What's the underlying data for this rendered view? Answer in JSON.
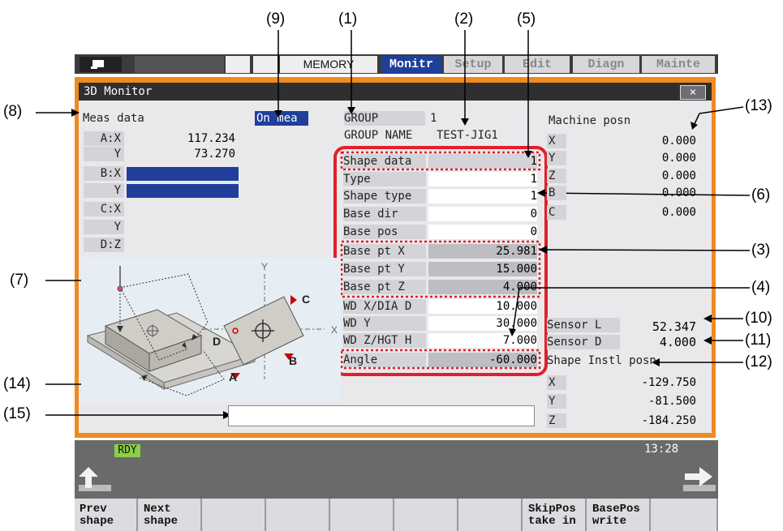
{
  "callouts": [
    "(1)",
    "(2)",
    "(3)",
    "(4)",
    "(5)",
    "(6)",
    "(7)",
    "(8)",
    "(9)",
    "(10)",
    "(11)",
    "(12)",
    "(13)",
    "(14)",
    "(15)"
  ],
  "topbar": {
    "mode": "MEMORY",
    "tabs": [
      "Monitr",
      "Setup",
      "Edit",
      "Diagn",
      "Mainte"
    ]
  },
  "window": {
    "title": "3D Monitor",
    "close": "×"
  },
  "meas": {
    "label": "Meas data",
    "status": "On mea",
    "rows": [
      {
        "label": "A:X",
        "value": "117.234"
      },
      {
        "label": "Y",
        "value": "73.270"
      },
      {
        "label": "B:X",
        "value": ""
      },
      {
        "label": "Y",
        "value": ""
      },
      {
        "label": "C:X",
        "value": ""
      },
      {
        "label": "Y",
        "value": ""
      },
      {
        "label": "D:Z",
        "value": ""
      }
    ]
  },
  "group": {
    "label": "GROUP",
    "value": "1",
    "name_label": "GROUP NAME",
    "name_value": "TEST-JIG1"
  },
  "shape": {
    "rows": [
      {
        "label": "Shape data",
        "value": "1"
      },
      {
        "label": "Type",
        "value": "1"
      },
      {
        "label": "Shape type",
        "value": "1"
      },
      {
        "label": "Base dir",
        "value": "0"
      },
      {
        "label": "Base pos",
        "value": "0"
      },
      {
        "label": "Base pt X",
        "value": "25.981"
      },
      {
        "label": "Base pt Y",
        "value": "15.000"
      },
      {
        "label": "Base pt Z",
        "value": "4.000"
      },
      {
        "label": "WD X/DIA D",
        "value": "10.000"
      },
      {
        "label": "WD Y",
        "value": "30.000"
      },
      {
        "label": "WD Z/HGT H",
        "value": "7.000"
      },
      {
        "label": "Angle",
        "value": "-60.000"
      }
    ]
  },
  "machine": {
    "label": "Machine posn",
    "rows": [
      {
        "label": "X",
        "value": "0.000"
      },
      {
        "label": "Y",
        "value": "0.000"
      },
      {
        "label": "Z",
        "value": "0.000"
      },
      {
        "label": "B",
        "value": "0.000"
      },
      {
        "label": "C",
        "value": "0.000"
      }
    ]
  },
  "sensor": {
    "l_label": "Sensor L",
    "l_value": "52.347",
    "d_label": "Sensor D",
    "d_value": "4.000"
  },
  "instl": {
    "label": "Shape Instl posn",
    "rows": [
      {
        "label": "X",
        "value": "-129.750"
      },
      {
        "label": "Y",
        "value": "-81.500"
      },
      {
        "label": "Z",
        "value": "-184.250"
      }
    ]
  },
  "diagram": {
    "axis_y": "Y",
    "axis_x": "X",
    "pt_a": "A",
    "pt_b": "B",
    "pt_c": "C",
    "pt_d": "D"
  },
  "status": {
    "rdy": "RDY",
    "time": "13:28"
  },
  "fkeys": [
    {
      "l1": "Prev",
      "l2": "shape"
    },
    {
      "l1": "Next",
      "l2": "shape"
    },
    {
      "l1": "",
      "l2": ""
    },
    {
      "l1": "",
      "l2": ""
    },
    {
      "l1": "",
      "l2": ""
    },
    {
      "l1": "",
      "l2": ""
    },
    {
      "l1": "",
      "l2": ""
    },
    {
      "l1": "SkipPos",
      "l2": "take in"
    },
    {
      "l1": "BasePos",
      "l2": "write"
    },
    {
      "l1": "",
      "l2": ""
    }
  ],
  "colors": {
    "frame": "#f08a20",
    "highlight": "#e0202a",
    "select": "#1f3f9a"
  }
}
